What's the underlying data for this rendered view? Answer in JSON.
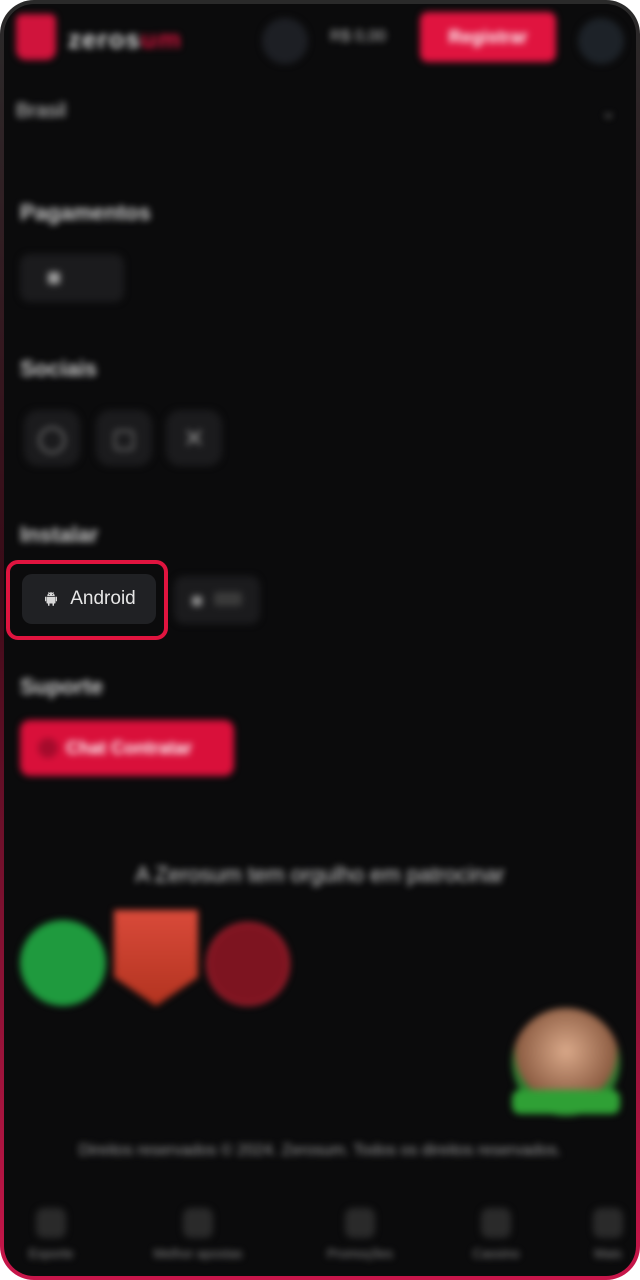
{
  "header": {
    "logo_text_a": "zeros",
    "logo_text_b": "um",
    "balance": "R$ 0,00",
    "register_label": "Registrar"
  },
  "country": {
    "label": "Brasil",
    "chevron": "⌄"
  },
  "sections": {
    "payments_title": "Pagamentos",
    "social_title": "Sociais",
    "apps_title": "Instalar",
    "support_title": "Suporte"
  },
  "social_icons": [
    "whatsapp-icon",
    "instagram-icon",
    "x-icon"
  ],
  "apps": {
    "android_label": "Android"
  },
  "support": {
    "chat_label": "Chat Contratar"
  },
  "sponsors": {
    "text": "A Zerosum tem orgulho em patrocinar"
  },
  "footer": {
    "copyright": "Direitos reservados © 2024. Zerosum. Todos os direitos reservados."
  },
  "bottom_nav": [
    {
      "label": "Esporte"
    },
    {
      "label": "Melhor apostas"
    },
    {
      "label": "Promoções"
    },
    {
      "label": "Cassino"
    },
    {
      "label": "Mais"
    }
  ],
  "colors": {
    "accent": "#e0143f",
    "background": "#0b0b0c",
    "button_dark": "#202124"
  }
}
